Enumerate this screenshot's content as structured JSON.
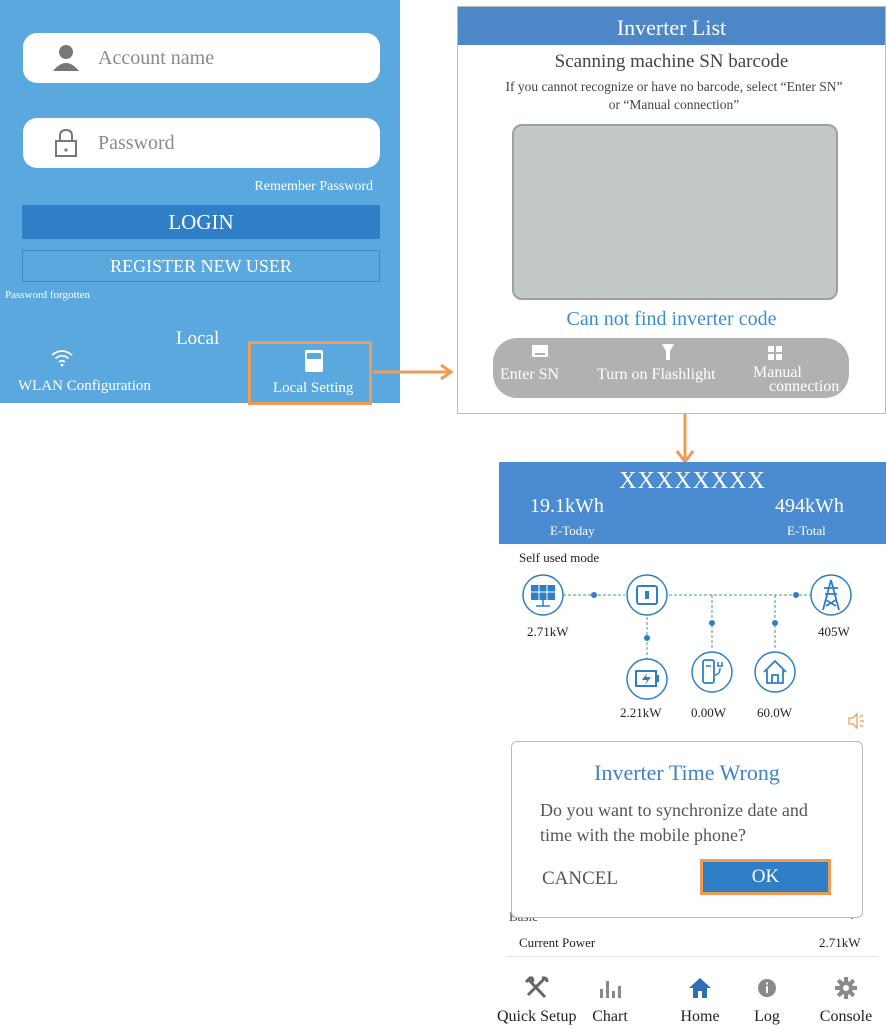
{
  "login": {
    "account_placeholder": "Account name",
    "password_placeholder": "Password",
    "remember_password": "Remember Password",
    "login_button": "LOGIN",
    "register_button": "REGISTER NEW USER",
    "password_forgotten": "Password forgotten",
    "local_label": "Local",
    "wlan_configuration": "WLAN Configuration",
    "local_setting": "Local Setting"
  },
  "inverter_list": {
    "title": "Inverter List",
    "scan_title": "Scanning machine SN barcode",
    "scan_desc_line1": "If you cannot recognize or have no barcode, select “Enter SN”",
    "scan_desc_line2": "or “Manual connection”",
    "not_found": "Can not find inverter code",
    "actions": {
      "enter_sn": "Enter SN",
      "flashlight": "Turn on Flashlight",
      "manual_line1": "Manual",
      "manual_line2": "connection"
    }
  },
  "home": {
    "serial": "XXXXXXXX",
    "e_today_value": "19.1kWh",
    "e_today_label": "E-Today",
    "e_total_value": "494kWh",
    "e_total_label": "E-Total",
    "mode": "Self used mode",
    "flow": {
      "pv_power": "2.71kW",
      "grid_power": "405W",
      "battery_power": "2.21kW",
      "ev_power": "0.00W",
      "home_power": "60.0W"
    },
    "dialog": {
      "title": "Inverter Time Wrong",
      "message_line1": "Do you want to synchronize date and",
      "message_line2": "time with the mobile phone?",
      "cancel": "CANCEL",
      "ok": "OK"
    },
    "basic_label": "Basic",
    "current_power_label": "Current Power",
    "current_power_value": "2.71kW",
    "nav": {
      "quick_setup": "Quick Setup",
      "chart": "Chart",
      "home": "Home",
      "log": "Log",
      "console": "Console"
    }
  },
  "colors": {
    "login_bg": "#5ba8de",
    "header_blue": "#4a8bd1",
    "button_blue": "#2f7fc6",
    "highlight_orange": "#ee9b55",
    "flow_green": "#3aa574",
    "icon_blue": "#2f7fc6"
  }
}
